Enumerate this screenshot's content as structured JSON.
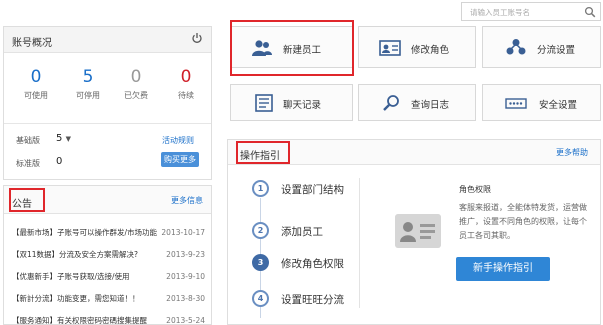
{
  "search": {
    "placeholder": "请输入员工账号名"
  },
  "account": {
    "title": "账号概况",
    "stats": [
      {
        "value": "0",
        "label": "可使用",
        "color": "#1a6fc9"
      },
      {
        "value": "5",
        "label": "可停用",
        "color": "#1a6fc9"
      },
      {
        "value": "0",
        "label": "已欠费",
        "color": "#999999"
      },
      {
        "value": "0",
        "label": "待续",
        "color": "#d0202a"
      }
    ],
    "version_label": "基础版",
    "version_value": "5",
    "version_link": "活动规则",
    "standard_label": "标准版",
    "standard_value": "0",
    "buy_button": "购买更多"
  },
  "notice": {
    "title": "公告",
    "more": "更多信息",
    "items": [
      {
        "text": "【最新市场】子账号可以操作群发/市场功能",
        "date": "2013-10-17"
      },
      {
        "text": "【双11数据】分流及安全方案需解决?",
        "date": "2013-9-23"
      },
      {
        "text": "【优惠新手】子账号获取/选接/使用",
        "date": "2013-9-10"
      },
      {
        "text": "【新計分流】功能变更，需您知道！！",
        "date": "2013-8-30"
      },
      {
        "text": "【服务通知】有关权限密码密碼搜集提醒",
        "date": "2013-5-24"
      }
    ]
  },
  "actions": [
    {
      "label": "新建员工",
      "icon": "users-icon"
    },
    {
      "label": "修改角色",
      "icon": "id-card-icon"
    },
    {
      "label": "分流设置",
      "icon": "diversion-icon"
    },
    {
      "label": "聊天记录",
      "icon": "chat-log-icon"
    },
    {
      "label": "查询日志",
      "icon": "magnifier-icon"
    },
    {
      "label": "安全设置",
      "icon": "security-icon"
    }
  ],
  "guide": {
    "title": "操作指引",
    "more": "更多帮助",
    "steps": [
      {
        "num": "1",
        "label": "设置部门结构"
      },
      {
        "num": "2",
        "label": "添加员工"
      },
      {
        "num": "3",
        "label": "修改角色权限"
      },
      {
        "num": "4",
        "label": "设置旺旺分流"
      }
    ],
    "role_title": "角色权限",
    "role_desc": "客服来报道，全能体特发货，运营做推广，设置不同角色的权限，让每个员工各司其职。",
    "button": "新手操作指引"
  },
  "colors": {
    "accent": "#2f86d6",
    "highlight": "#e0262b"
  }
}
